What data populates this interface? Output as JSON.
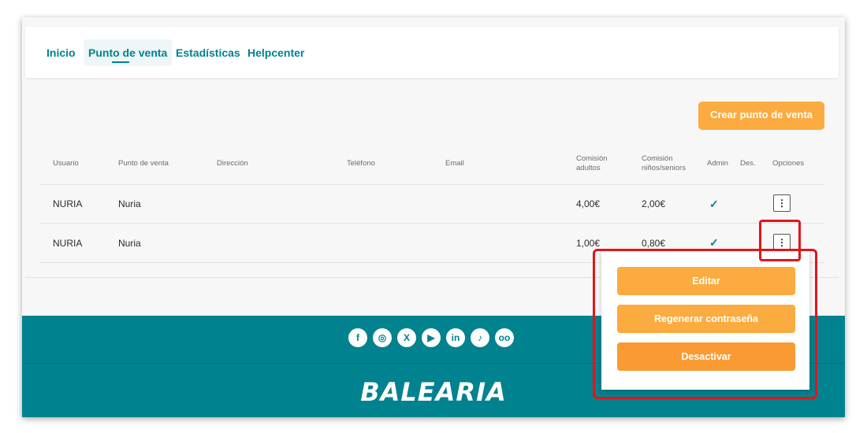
{
  "nav": {
    "tabs": [
      {
        "label": "Inicio",
        "active": false
      },
      {
        "label": "Punto de venta",
        "active": true
      },
      {
        "label": "Estadísticas",
        "active": false
      },
      {
        "label": "Helpcenter",
        "active": false
      }
    ]
  },
  "actions": {
    "create_label": "Crear punto de venta"
  },
  "table": {
    "headers": {
      "usuario": "Usuario",
      "punto": "Punto de venta",
      "direccion": "Dirección",
      "telefono": "Teléfono",
      "email": "Email",
      "comision_adultos": [
        "Comisión",
        "adultos"
      ],
      "comision_ninos": [
        "Comisión",
        "niños/seniors"
      ],
      "admin": "Admin",
      "des": "Des.",
      "opciones": "Opciones"
    },
    "rows": [
      {
        "usuario": "NURIA",
        "punto": "Nuria",
        "comision_adultos": "4,00€",
        "comision_ninos": "2,00€",
        "admin_icon": "check-icon",
        "options_icon": "⋮"
      },
      {
        "usuario": "NURIA",
        "punto": "Nuria",
        "comision_adultos": "1,00€",
        "comision_ninos": "0,80€",
        "admin_icon": "check-icon",
        "options_icon": "⋮"
      }
    ]
  },
  "menu": {
    "items": [
      "Editar",
      "Regenerar contraseña",
      "Desactivar"
    ]
  },
  "footer": {
    "social": [
      {
        "icon": "facebook-icon",
        "glyph": "f"
      },
      {
        "icon": "instagram-icon",
        "glyph": "◎"
      },
      {
        "icon": "x-icon",
        "glyph": "X"
      },
      {
        "icon": "youtube-icon",
        "glyph": "▶"
      },
      {
        "icon": "linkedin-icon",
        "glyph": "in"
      },
      {
        "icon": "tiktok-icon",
        "glyph": "♪"
      },
      {
        "icon": "tripadvisor-icon",
        "glyph": "oo"
      }
    ],
    "brand": "BALEARIA"
  },
  "colors": {
    "accent": "#00828f",
    "button": "#fbab3f",
    "highlight": "#e3141b"
  }
}
